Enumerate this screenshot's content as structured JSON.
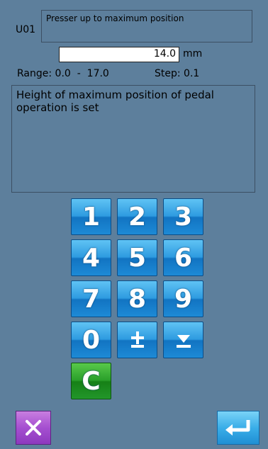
{
  "parameter": {
    "code": "U01",
    "title": "Presser up to maximum position"
  },
  "value": {
    "current": "14.0",
    "unit": "mm"
  },
  "range": {
    "text": "Range: 0.0  -  17.0",
    "step": "Step: 0.1"
  },
  "description": "Height of maximum position of pedal operation is set",
  "keypad": {
    "k1": "1",
    "k2": "2",
    "k3": "3",
    "k4": "4",
    "k5": "5",
    "k6": "6",
    "k7": "7",
    "k8": "8",
    "k9": "9",
    "k0": "0",
    "clear": "C",
    "plus_minus_icon": "plus-minus-icon",
    "decimal_icon": "decimal-point-icon"
  },
  "footer": {
    "cancel_icon": "close-icon",
    "enter_icon": "enter-return-icon"
  },
  "colors": {
    "background": "#5d7f9c",
    "key_blue": "#2e9be0",
    "key_green": "#2a9f2a",
    "cancel_purple": "#a54fd0"
  }
}
